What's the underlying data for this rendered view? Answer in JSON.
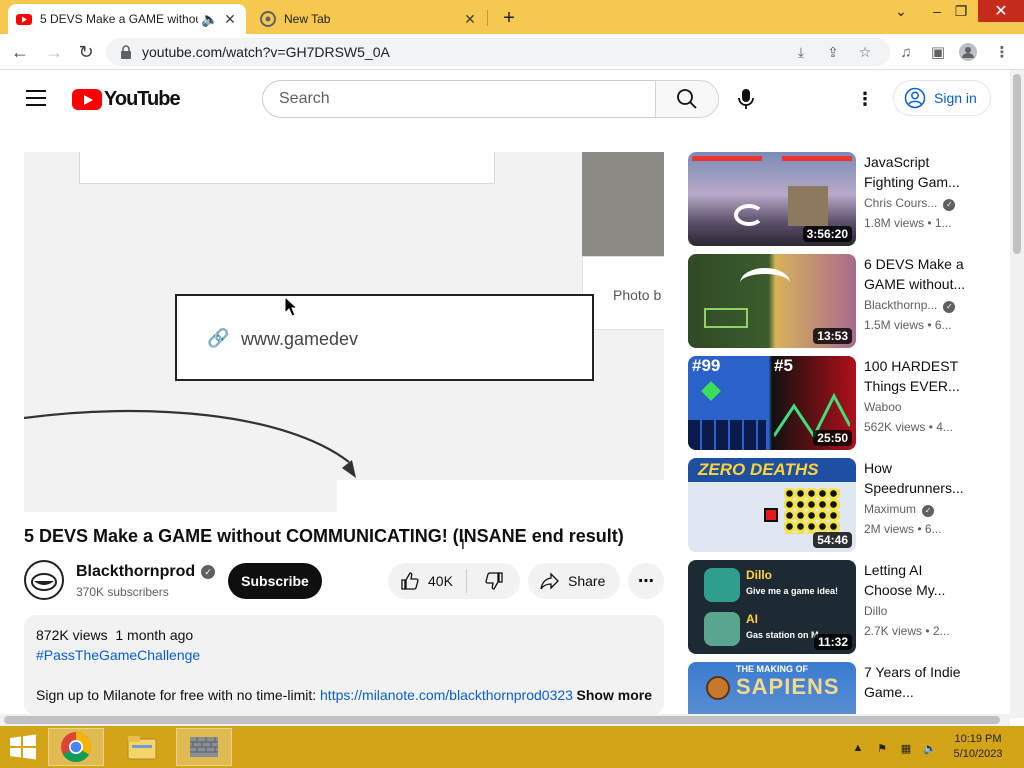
{
  "browser": {
    "tabs": [
      {
        "title": "5 DEVS Make a GAME without COMMUNICATING! (INSANE end result)",
        "active": true,
        "audio": true
      },
      {
        "title": "New Tab",
        "active": false
      }
    ],
    "url": "youtube.com/watch?v=GH7DRSW5_0A",
    "window_controls": {
      "minimize": "–",
      "maximize": "❐",
      "close": "✕"
    }
  },
  "header": {
    "logo_text": "YouTube",
    "search_placeholder": "Search",
    "signin_label": "Sign in"
  },
  "player": {
    "link_text": "www.gamedev",
    "photo_label": "Photo b"
  },
  "video": {
    "title": "5 DEVS Make a GAME without COMMUNICATING! (INSANE end result)",
    "channel": "Blackthornprod",
    "subscribers": "370K subscribers",
    "subscribe_label": "Subscribe",
    "likes": "40K",
    "share_label": "Share"
  },
  "description": {
    "views": "872K views",
    "age": "1 month ago",
    "hashtag": "#PassTheGameChallenge",
    "body_text": "Sign up to Milanote for free with no time-limit: ",
    "body_link": "https://milanote.com/blackthornprod0323",
    "show_more": "Show more"
  },
  "recommendations": [
    {
      "title": "JavaScript Fighting Gam...",
      "channel": "Chris Cours...",
      "verified": true,
      "meta": "1.8M views  •  1...",
      "duration": "3:56:20"
    },
    {
      "title": "6 DEVS Make a GAME without...",
      "channel": "Blackthornp...",
      "verified": true,
      "meta": "1.5M views  •  6...",
      "duration": "13:53"
    },
    {
      "title": "100 HARDEST Things EVER...",
      "channel": "Waboo",
      "verified": false,
      "meta": "562K views  •  4...",
      "duration": "25:50",
      "thumb_text_left": "#99",
      "thumb_text_right": "#5"
    },
    {
      "title": "How Speedrunners...",
      "channel": "Maximum",
      "verified": true,
      "meta": "2M views  •  6...",
      "duration": "54:46",
      "thumb_text": "ZERO DEATHS"
    },
    {
      "title": "Letting AI Choose My...",
      "channel": "Dillo",
      "verified": false,
      "meta": "2.7K views  •  2...",
      "duration": "11:32",
      "thumb_line1": "Dillo",
      "thumb_line2": "Give me a game idea!",
      "thumb_line3": "AI",
      "thumb_line4": "Gas station on M"
    },
    {
      "title": "7 Years of Indie Game...",
      "channel": "",
      "verified": false,
      "meta": "",
      "duration": "",
      "thumb_text_small": "THE MAKING OF",
      "thumb_text_big": "SAPIENS"
    }
  ],
  "taskbar": {
    "time": "10:19 PM",
    "date": "5/10/2023"
  },
  "colors": {
    "chrome_frame": "#f6c84f",
    "taskbar": "#d4a418",
    "youtube_red": "#ff0000",
    "link_blue": "#065fd4"
  }
}
